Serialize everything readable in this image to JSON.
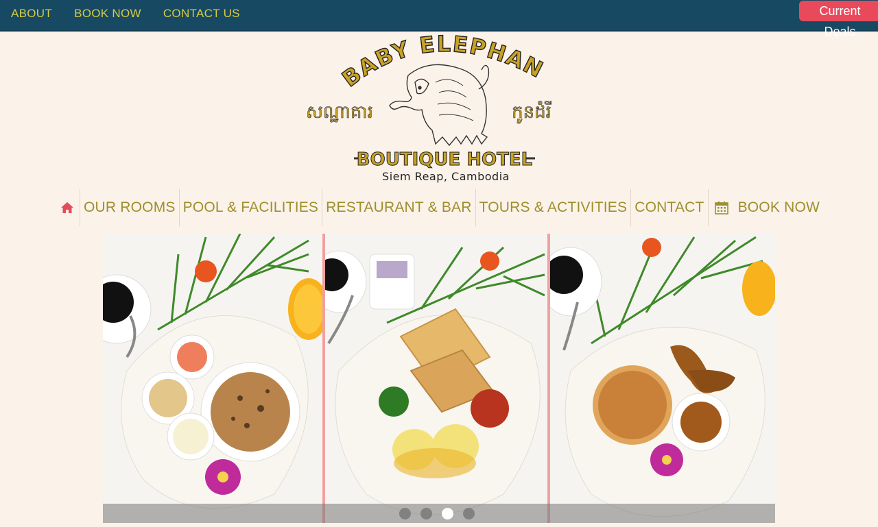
{
  "topbar": {
    "links": [
      "ABOUT",
      "BOOK NOW",
      "CONTACT US"
    ],
    "deals_label": "Current Deals"
  },
  "logo": {
    "arc_text": "BABY ELEPHANT",
    "khmer_left": "សណ្ឋាគារ",
    "khmer_right": "កូនដំរី",
    "subtitle": "BOUTIQUE HOTEL",
    "location": "Siem Reap, Cambodia"
  },
  "nav": {
    "home_icon": "home-icon",
    "items": [
      "OUR ROOMS",
      "POOL & FACILITIES",
      "RESTAURANT & BAR",
      "TOURS & ACTIVITIES",
      "CONTACT"
    ],
    "book_icon": "calendar-icon",
    "book_label": "BOOK NOW"
  },
  "carousel": {
    "slides": [
      "muesli-breakfast-photo",
      "eggs-benedict-breakfast-photo",
      "pancake-breakfast-photo"
    ],
    "dots": 4,
    "active_dot": 3
  },
  "colors": {
    "topbar": "#174a62",
    "topbar_link": "#d8cb44",
    "deals": "#e84a5c",
    "nav_text": "#9e8f2e",
    "home_icon": "#e84a5c",
    "logo_gold": "#c9a227",
    "page_bg": "#fbf2e9"
  }
}
